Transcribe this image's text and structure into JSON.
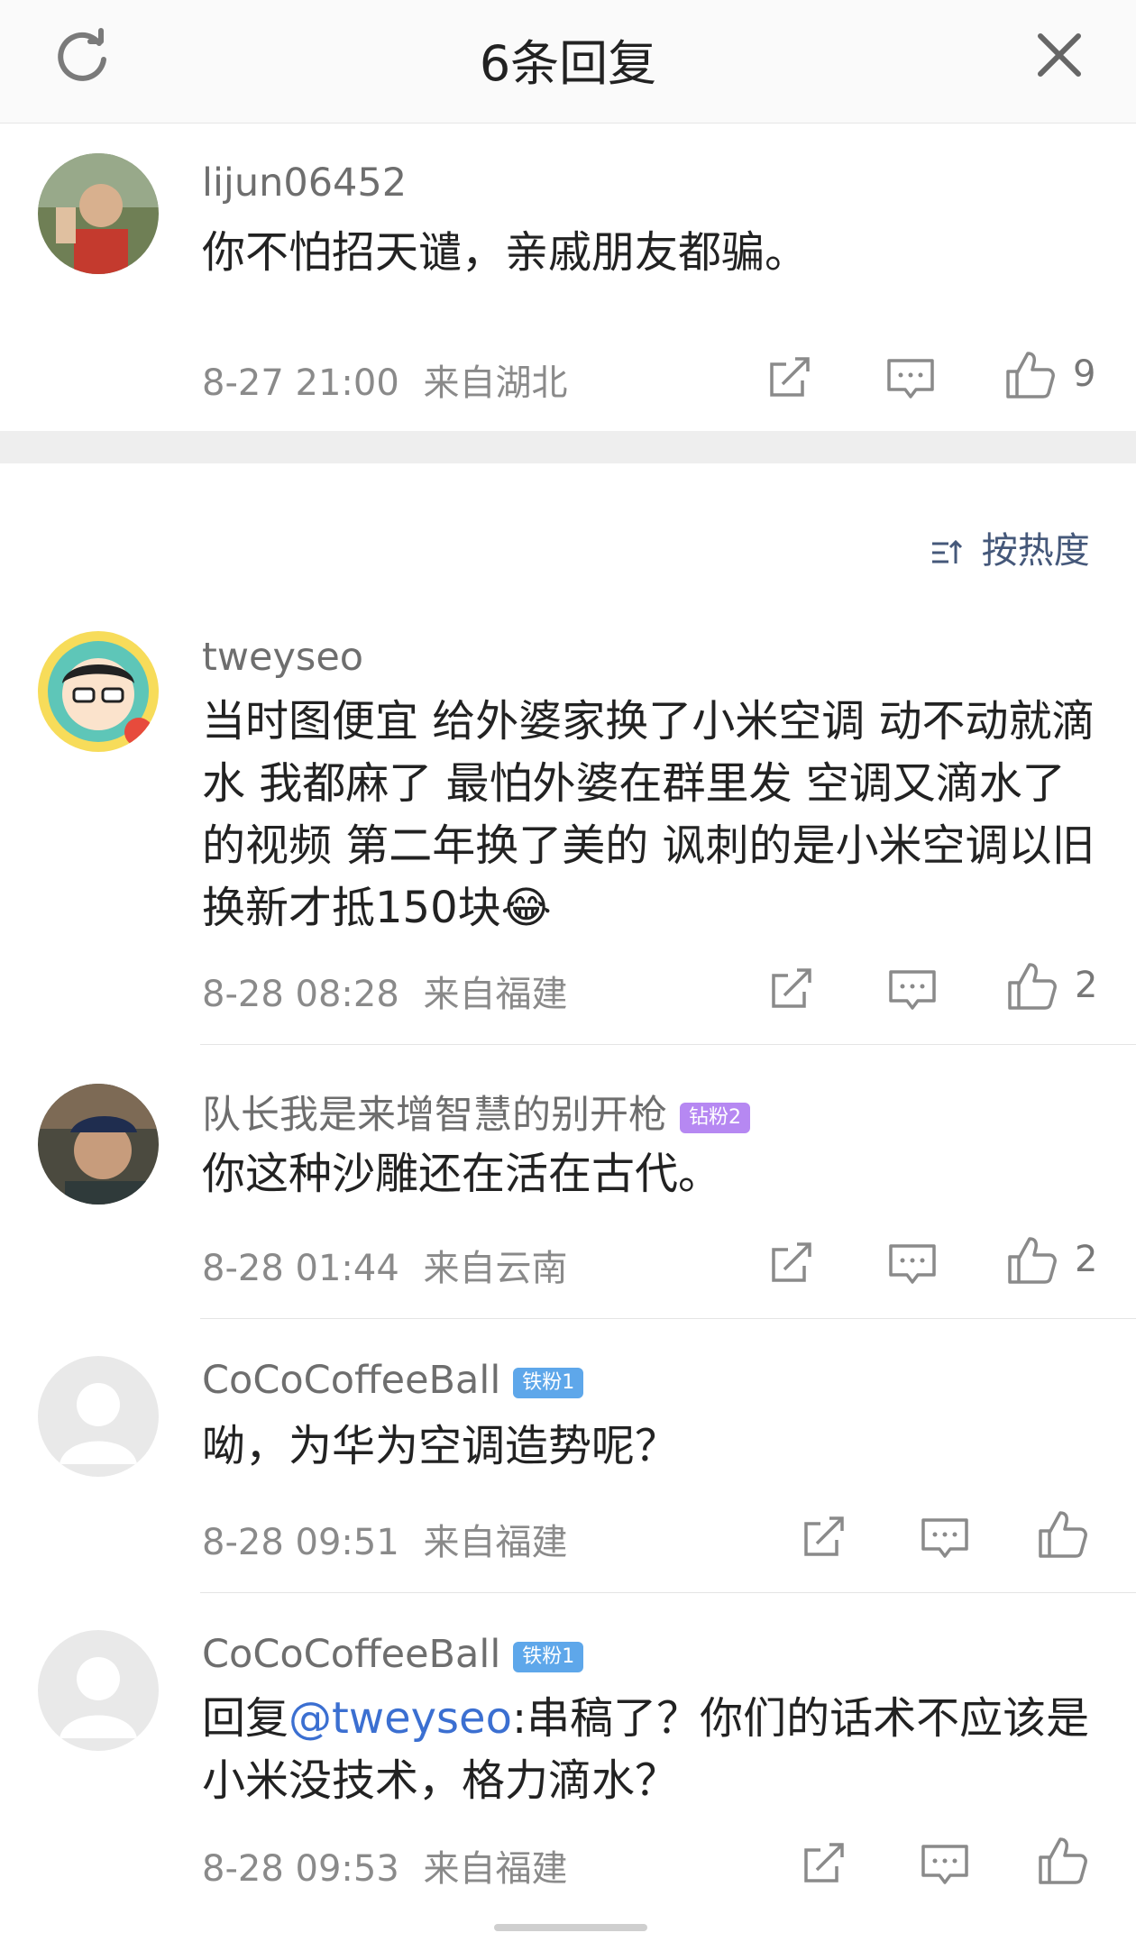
{
  "header": {
    "title": "6条回复"
  },
  "sort": {
    "label": "按热度"
  },
  "comments": [
    {
      "username": "lijun06452",
      "badge": "",
      "text": "你不怕招天谴，亲戚朋友都骗。",
      "mention": "",
      "rest": "",
      "time": "8-27 21:00",
      "location": "来自湖北",
      "likes": "9"
    },
    {
      "username": "tweyseo",
      "badge": "",
      "text": "当时图便宜 给外婆家换了小米空调 动不动就滴水 我都麻了 最怕外婆在群里发 空调又滴水了的视频 第二年换了美的 讽刺的是小米空调以旧换新才抵150块😂",
      "mention": "",
      "rest": "",
      "time": "8-28 08:28",
      "location": "来自福建",
      "likes": "2"
    },
    {
      "username": "队长我是来增智慧的别开枪",
      "badge": "钻粉2",
      "text": "你这种沙雕还在活在古代。",
      "mention": "",
      "rest": "",
      "time": "8-28 01:44",
      "location": "来自云南",
      "likes": "2"
    },
    {
      "username": "CoCoCoffeeBall",
      "badge": "铁粉1",
      "text": "呦，为华为空调造势呢？",
      "mention": "",
      "rest": "",
      "time": "8-28 09:51",
      "location": "来自福建",
      "likes": ""
    },
    {
      "username": "CoCoCoffeeBall",
      "badge": "铁粉1",
      "text": "回复",
      "mention": "@tweyseo",
      "rest": ":串稿了？你们的话术不应该是小米没技术，格力滴水？",
      "time": "8-28 09:53",
      "location": "来自福建",
      "likes": ""
    }
  ],
  "icons": {
    "refresh": "refresh-icon",
    "close": "close-icon",
    "share": "share-icon",
    "reply": "comment-icon",
    "like": "thumbs-up-icon",
    "sort": "sort-icon"
  }
}
